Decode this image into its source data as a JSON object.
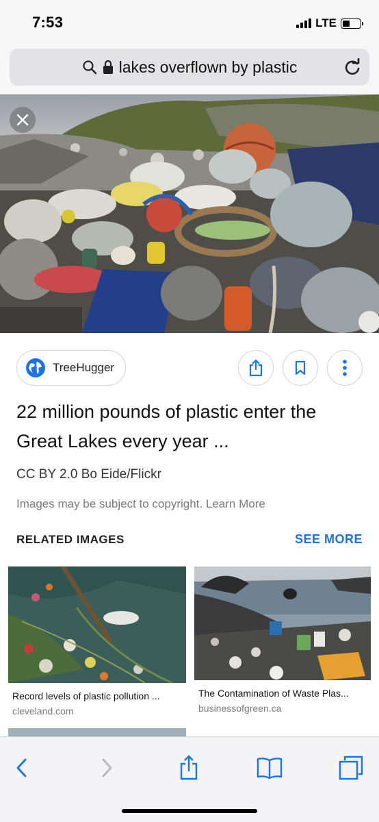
{
  "status_bar": {
    "time": "7:53",
    "network": "LTE"
  },
  "address_bar": {
    "query": "lakes overflown by plastic"
  },
  "result": {
    "source_name": "TreeHugger",
    "title": "22 million pounds of plastic enter the Great Lakes every year ...",
    "credit": "CC BY 2.0 Bo Eide/Flickr",
    "copyright_notice": "Images may be subject to copyright.",
    "learn_more": "Learn More"
  },
  "related": {
    "header": "RELATED IMAGES",
    "see_more": "SEE MORE",
    "items": [
      {
        "caption": "Record levels of plastic pollution ...",
        "domain": "cleveland.com"
      },
      {
        "caption": "The Contamination of Waste Plas...",
        "domain": "businessofgreen.ca"
      }
    ]
  },
  "colors": {
    "accent": "#1a73e8",
    "chrome_bg": "#f7f7f7"
  },
  "icons": {
    "status": [
      "signal-icon",
      "battery-icon"
    ],
    "address": [
      "search-icon",
      "lock-icon",
      "reload-icon"
    ],
    "actions": [
      "share-icon",
      "bookmark-icon",
      "more-icon"
    ],
    "toolbar": [
      "back-icon",
      "forward-icon",
      "share-icon",
      "bookmarks-icon",
      "tabs-icon"
    ]
  }
}
